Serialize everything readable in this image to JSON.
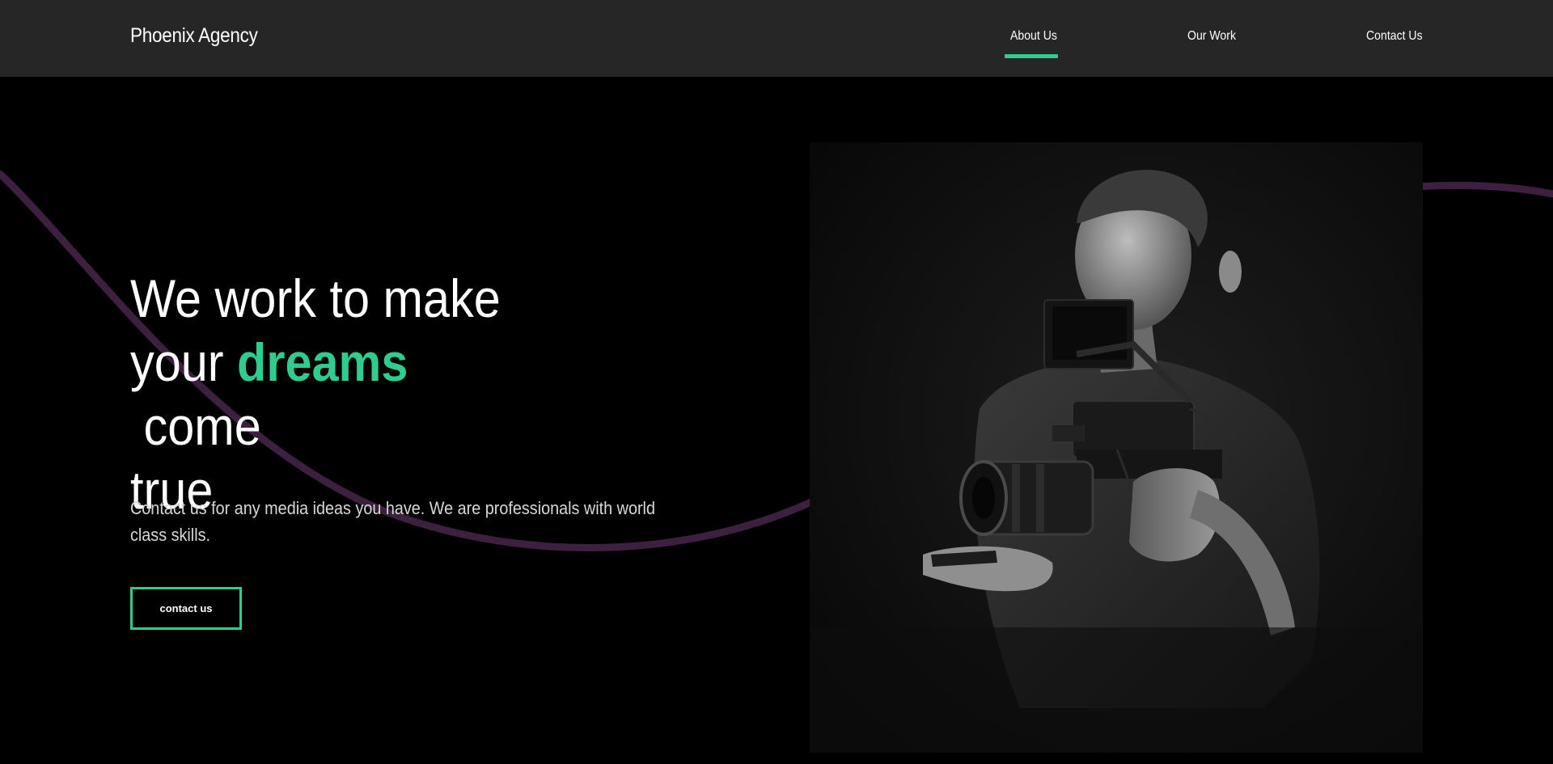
{
  "colors": {
    "accent": "#2ecc8f",
    "curve": "#3d1f40",
    "header_bg": "#262626",
    "page_bg": "#000000"
  },
  "header": {
    "logo": "Phoenix Agency",
    "nav": [
      {
        "label": "About Us",
        "active": true
      },
      {
        "label": "Our Work",
        "active": false
      },
      {
        "label": "Contact Us",
        "active": false
      }
    ]
  },
  "hero": {
    "headline_line1": "We work to make",
    "headline_line2_pre": "your ",
    "headline_accent": "dreams",
    "headline_line2_post": " come",
    "headline_line3": "true",
    "subtext": "Contact us for any media ideas you have. We are professionals with world class skills.",
    "cta_label": "contact us"
  },
  "photo": {
    "subject": "black-and-white photo of a videographer operating a cinema camera"
  }
}
